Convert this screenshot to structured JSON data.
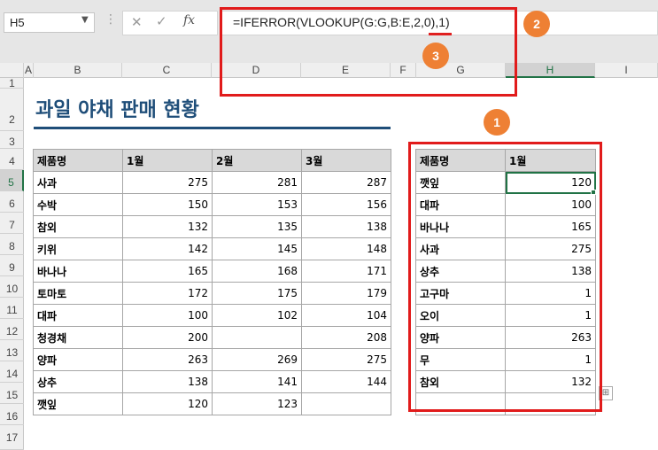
{
  "formula_bar": {
    "name_box": "H5",
    "fx_label": "fx",
    "formula": "=IFERROR(VLOOKUP(G:G,B:E,2,0),1)"
  },
  "columns": [
    "A",
    "B",
    "C",
    "D",
    "E",
    "F",
    "G",
    "H",
    "I"
  ],
  "rows": [
    "1",
    "2",
    "3",
    "4",
    "5",
    "6",
    "7",
    "8",
    "9",
    "10",
    "11",
    "12",
    "13",
    "14",
    "15",
    "16",
    "17"
  ],
  "title": "과일 야채 판매 현황",
  "left_table": {
    "headers": [
      "제품명",
      "1월",
      "2월",
      "3월"
    ],
    "rows": [
      [
        "사과",
        "275",
        "281",
        "287"
      ],
      [
        "수박",
        "150",
        "153",
        "156"
      ],
      [
        "참외",
        "132",
        "135",
        "138"
      ],
      [
        "키위",
        "142",
        "145",
        "148"
      ],
      [
        "바나나",
        "165",
        "168",
        "171"
      ],
      [
        "토마토",
        "172",
        "175",
        "179"
      ],
      [
        "대파",
        "100",
        "102",
        "104"
      ],
      [
        "청경채",
        "200",
        "",
        "208"
      ],
      [
        "양파",
        "263",
        "269",
        "275"
      ],
      [
        "상추",
        "138",
        "141",
        "144"
      ],
      [
        "깻잎",
        "120",
        "123",
        ""
      ]
    ]
  },
  "right_table": {
    "headers": [
      "제품명",
      "1월"
    ],
    "rows": [
      [
        "깻잎",
        "120"
      ],
      [
        "대파",
        "100"
      ],
      [
        "바나나",
        "165"
      ],
      [
        "사과",
        "275"
      ],
      [
        "상추",
        "138"
      ],
      [
        "고구마",
        "1"
      ],
      [
        "오이",
        "1"
      ],
      [
        "양파",
        "263"
      ],
      [
        "무",
        "1"
      ],
      [
        "참외",
        "132"
      ],
      [
        "",
        ""
      ]
    ]
  },
  "badges": [
    "1",
    "2",
    "3"
  ],
  "colors": {
    "annotation_red": "#e11b1b",
    "badge_orange": "#ee8034",
    "title_blue": "#1f4e79",
    "excel_green": "#217346"
  }
}
